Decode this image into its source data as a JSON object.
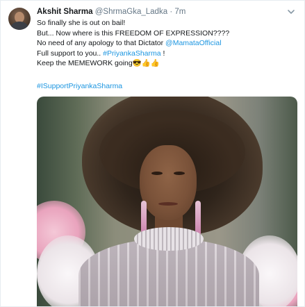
{
  "tweet": {
    "author_name": "Akshit Sharma",
    "handle": "@ShrmaGka_Ladka",
    "separator": "·",
    "time": "7m",
    "lines": {
      "line1": "So finally she is out on bail!",
      "line2": "But... Now where is this FREEDOM OF EXPRESSION????",
      "line3_prefix": "No need of any apology to that Dictator ",
      "line3_mention": "@MamataOfficial",
      "line4_prefix": "Full support to you.. ",
      "line4_hashtag": "#PriyankaSharma",
      "line4_suffix": " !",
      "line5": "Keep the MEMEWORK going😎👍👍"
    },
    "hashtag": "#ISupportPriyankaSharma"
  },
  "icons": {
    "avatar": "avatar",
    "menu": "chevron-down-icon"
  },
  "colors": {
    "link": "#1b95e0",
    "secondary_text": "#657786",
    "primary_text": "#14171a"
  }
}
